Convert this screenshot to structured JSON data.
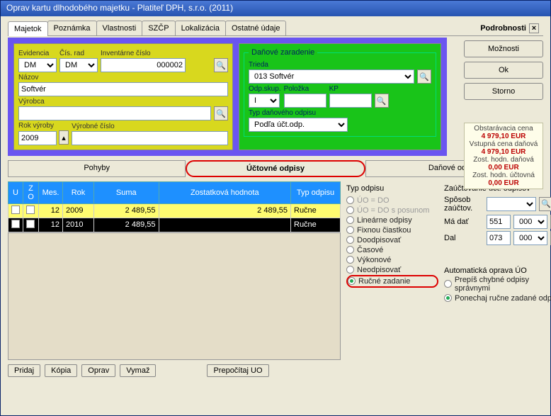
{
  "title": "Oprav kartu dlhodobého majetku - Platiteľ DPH, s.r.o. (2011)",
  "tabs": [
    "Majetok",
    "Poznámka",
    "Vlastnosti",
    "SZČP",
    "Lokalizácia",
    "Ostatné údaje"
  ],
  "podrobnosti": "Podrobnosti",
  "buttons": {
    "moznosti": "Možnosti",
    "ok": "Ok",
    "storno": "Storno"
  },
  "yellow": {
    "evidencia_l": "Evidencia",
    "evidencia_v": "DM",
    "cisrad_l": "Čís. rad",
    "cisrad_v": "DM",
    "invc_l": "Inventárne číslo",
    "invc_v": "000002",
    "nazov_l": "Názov",
    "nazov_v": "Softvér",
    "vyrobca_l": "Výrobca",
    "vyrobca_v": "",
    "rokvyr_l": "Rok výroby",
    "rokvyr_v": "2009",
    "vyrc_l": "Výrobné číslo",
    "vyrc_v": ""
  },
  "green": {
    "legend": "Daňové zaradenie",
    "trieda_l": "Trieda",
    "trieda_v": "013 Softvér",
    "odpskup_l": "Odp.skup.",
    "odpskup_v": "I",
    "polozka_l": "Položka",
    "polozka_v": "",
    "kp_l": "KP",
    "kp_v": "",
    "typ_l": "Typ daňového odpisu",
    "typ_v": "Podľa účt.odp."
  },
  "info": {
    "l1": "Obstarávacia cena",
    "v1": "4 979,10 EUR",
    "l2": "Vstupná cena daňová",
    "v2": "4 979,10 EUR",
    "l3": "Zost. hodn. daňová",
    "v3": "0,00 EUR",
    "l4": "Zost. hodn. účtovná",
    "v4": "0,00 EUR"
  },
  "subtabs": {
    "pohyby": "Pohyby",
    "uctovne": "Účtovné odpisy",
    "danove": "Daňové odpisy"
  },
  "gridh": {
    "u": "U",
    "zo": "Z O",
    "mes": "Mes.",
    "rok": "Rok",
    "suma": "Suma",
    "zost": "Zostatková hodnota",
    "typ": "Typ odpisu"
  },
  "rows": [
    {
      "mes": "12",
      "rok": "2009",
      "suma": "2 489,55",
      "zost": "2 489,55",
      "typ": "Ručne",
      "sel": true
    },
    {
      "mes": "12",
      "rok": "2010",
      "suma": "2 489,55",
      "zost": "",
      "typ": "Ručne",
      "sel": false
    }
  ],
  "typodpisu": {
    "legend": "Typ odpisu",
    "o1": "ÚO = DO",
    "o2": "ÚO = DO s posunom",
    "o3": "Lineárne odpisy",
    "o4": "Fixnou čiastkou",
    "o5": "Doodpisovať",
    "o6": "Časové",
    "o7": "Výkonové",
    "o8": "Neodpisovať",
    "o9": "Ručné zadanie"
  },
  "zauct": {
    "legend": "Zaúčtovanie účt. odpisov",
    "sposob_l": "Spôsob zaúčtov.",
    "madat_l": "Má dať",
    "madat_v1": "551",
    "madat_v2": "000",
    "dal_l": "Dal",
    "dal_v1": "073",
    "dal_v2": "000"
  },
  "auto": {
    "legend": "Automatická oprava ÚO",
    "o1": "Prepíš chybné odpisy správnymi",
    "o2": "Ponechaj ručne zadané odpisy"
  },
  "bottom": {
    "pridaj": "Pridaj",
    "kopia": "Kópia",
    "oprav": "Oprav",
    "vymaz": "Vymaž",
    "prepocitaj": "Prepočítaj UO"
  }
}
